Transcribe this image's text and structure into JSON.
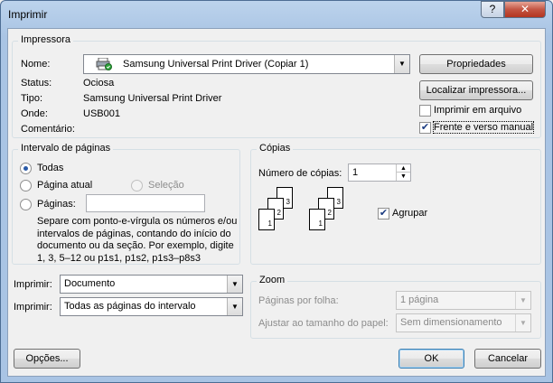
{
  "window": {
    "title": "Imprimir",
    "help_label": "?",
    "close_label": "✕"
  },
  "printer": {
    "group_label": "Impressora",
    "name_label": "Nome:",
    "name_value": "Samsung Universal Print Driver (Copiar 1)",
    "status_label": "Status:",
    "status_value": "Ociosa",
    "type_label": "Tipo:",
    "type_value": "Samsung Universal Print Driver",
    "where_label": "Onde:",
    "where_value": "USB001",
    "comment_label": "Comentário:",
    "properties_button": "Propriedades",
    "find_printer_button": "Localizar impressora...",
    "print_to_file_label": "Imprimir em arquivo",
    "print_to_file_checked": false,
    "duplex_label": "Frente e verso manual",
    "duplex_checked": true
  },
  "page_range": {
    "group_label": "Intervalo de páginas",
    "all_label": "Todas",
    "current_page_label": "Página atual",
    "selection_label": "Seleção",
    "pages_label": "Páginas:",
    "pages_value": "",
    "help_text": "Separe com ponto-e-vírgula os números e/ou intervalos de páginas, contando do início do documento ou da seção. Por exemplo, digite 1, 3, 5–12 ou p1s1, p1s2, p1s3–p8s3"
  },
  "copies": {
    "group_label": "Cópias",
    "count_label": "Número de cópias:",
    "count_value": "1",
    "collate_label": "Agrupar",
    "collate_checked": true,
    "page_numbers": [
      "1",
      "2",
      "3"
    ]
  },
  "print_what": {
    "label": "Imprimir:",
    "value": "Documento"
  },
  "print_range": {
    "label": "Imprimir:",
    "value": "Todas as páginas do intervalo"
  },
  "zoom": {
    "group_label": "Zoom",
    "pages_per_sheet_label": "Páginas por folha:",
    "pages_per_sheet_value": "1 página",
    "scale_label": "Ajustar ao tamanho do papel:",
    "scale_value": "Sem dimensionamento"
  },
  "footer": {
    "options_button": "Opções...",
    "ok_button": "OK",
    "cancel_button": "Cancelar"
  }
}
